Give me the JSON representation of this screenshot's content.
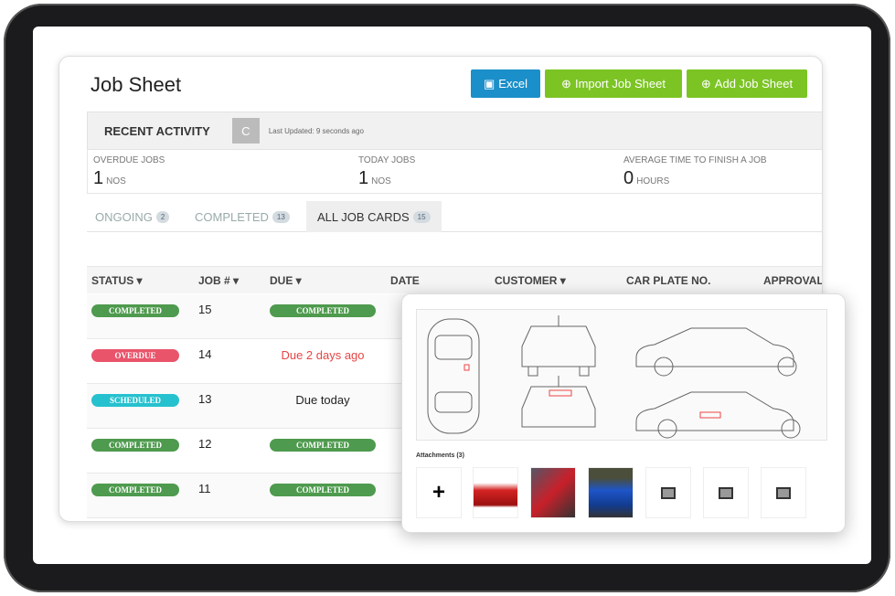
{
  "header": {
    "title": "Job Sheet",
    "excel": "Excel",
    "import": "Import Job Sheet",
    "add": "Add Job Sheet"
  },
  "activity": {
    "label": "RECENT ACTIVITY",
    "refresh_icon": "C",
    "updated": "Last Updated: 9 seconds ago"
  },
  "stats": [
    {
      "label": "OVERDUE JOBS",
      "value": "1",
      "unit": "NOS"
    },
    {
      "label": "TODAY JOBS",
      "value": "1",
      "unit": "NOS"
    },
    {
      "label": "AVERAGE TIME TO FINISH A JOB",
      "value": "0",
      "unit": "HOURS"
    }
  ],
  "tabs": [
    {
      "label": "ONGOING",
      "count": "2"
    },
    {
      "label": "COMPLETED",
      "count": "13"
    },
    {
      "label": "ALL JOB CARDS",
      "count": "15"
    }
  ],
  "columns": [
    "STATUS ▾",
    "JOB # ▾",
    "DUE ▾",
    "DATE",
    "CUSTOMER ▾",
    "CAR PLATE NO.",
    "APPROVAL"
  ],
  "rows": [
    {
      "status": "COMPLETED",
      "job": "15",
      "due": "COMPLETED"
    },
    {
      "status": "OVERDUE",
      "job": "14",
      "due": "Due 2 days ago"
    },
    {
      "status": "SCHEDULED",
      "job": "13",
      "due": "Due today"
    },
    {
      "status": "COMPLETED",
      "job": "12",
      "due": "COMPLETED"
    },
    {
      "status": "COMPLETED",
      "job": "11",
      "due": "COMPLETED"
    }
  ],
  "colors": {
    "completed": "#4e9a4e",
    "overdue": "#e9546b",
    "scheduled": "#26c1cf",
    "overdue_text": "#e64545"
  },
  "popup": {
    "attachments_label": "Attachments (3)",
    "add": "+"
  }
}
